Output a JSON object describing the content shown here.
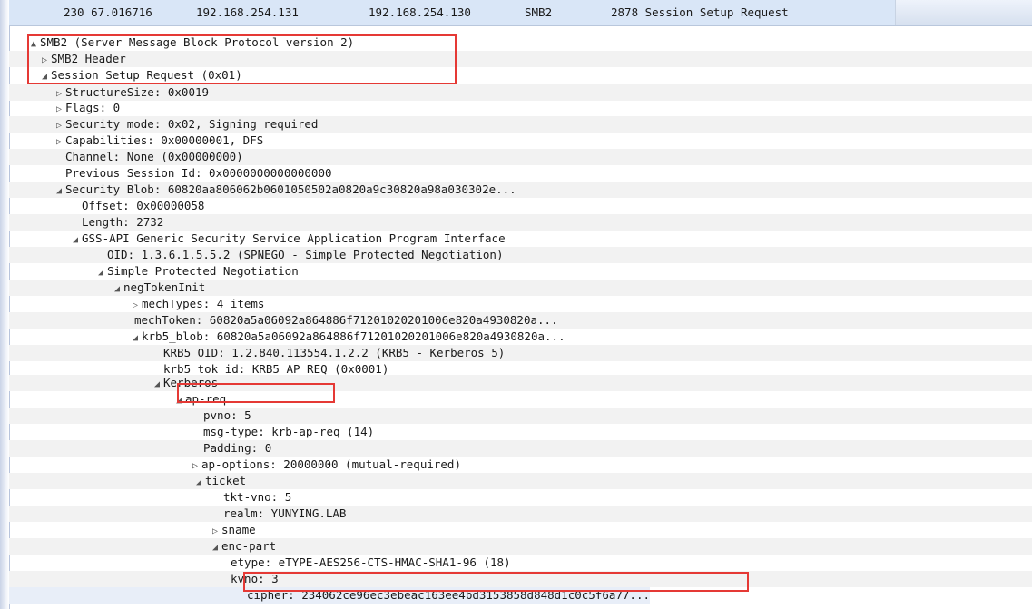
{
  "packet": {
    "no_time": "230 67.016716",
    "src": "192.168.254.131",
    "dst": "192.168.254.130",
    "proto": "SMB2",
    "info": "2878 Session Setup Request"
  },
  "tree": [
    {
      "t": "SMB2 (Server Message Block Protocol version 2)",
      "toggle": "▲"
    },
    {
      "t": "SMB2 Header",
      "toggle": "▷"
    },
    {
      "t": "Session Setup Request (0x01)",
      "toggle": "◢"
    },
    {
      "t": "StructureSize: 0x0019",
      "toggle": "▷"
    },
    {
      "t": "Flags: 0",
      "toggle": "▷"
    },
    {
      "t": "Security mode: 0x02, Signing required",
      "toggle": "▷"
    },
    {
      "t": "Capabilities: 0x00000001, DFS",
      "toggle": "▷"
    },
    {
      "t": "Channel: None (0x00000000)",
      "toggle": ""
    },
    {
      "t": "Previous Session Id: 0x0000000000000000",
      "toggle": ""
    },
    {
      "t": "Security Blob: 60820aa806062b0601050502a0820a9c30820a98a030302e...",
      "toggle": "◢"
    },
    {
      "t": "Offset: 0x00000058",
      "toggle": ""
    },
    {
      "t": "Length: 2732",
      "toggle": ""
    },
    {
      "t": "GSS-API Generic Security Service Application Program Interface",
      "toggle": "◢"
    },
    {
      "t": "OID: 1.3.6.1.5.5.2 (SPNEGO - Simple Protected Negotiation)",
      "toggle": ""
    },
    {
      "t": "Simple Protected Negotiation",
      "toggle": "◢"
    },
    {
      "t": "negTokenInit",
      "toggle": "◢"
    },
    {
      "t": "mechTypes: 4 items",
      "toggle": "▷"
    },
    {
      "t": "mechToken: 60820a5a06092a864886f71201020201006e820a4930820a...",
      "toggle": ""
    },
    {
      "t": "krb5_blob: 60820a5a06092a864886f71201020201006e820a4930820a...",
      "toggle": "◢"
    },
    {
      "t": "KRB5 OID: 1.2.840.113554.1.2.2 (KRB5 - Kerberos 5)",
      "toggle": ""
    },
    {
      "t": "krb5_tok_id: KRB5_AP_REQ (0x0001)",
      "toggle": ""
    },
    {
      "t": "Kerberos",
      "toggle": "◢"
    },
    {
      "t": "ap-req",
      "toggle": "◢"
    },
    {
      "t": "pvno: 5",
      "toggle": ""
    },
    {
      "t": "msg-type: krb-ap-req (14)",
      "toggle": ""
    },
    {
      "t": "Padding: 0",
      "toggle": ""
    },
    {
      "t": "ap-options: 20000000 (mutual-required)",
      "toggle": "▷"
    },
    {
      "t": "ticket",
      "toggle": "◢"
    },
    {
      "t": "tkt-vno: 5",
      "toggle": ""
    },
    {
      "t": "realm: YUNYING.LAB",
      "toggle": ""
    },
    {
      "t": "sname",
      "toggle": "▷"
    },
    {
      "t": "enc-part",
      "toggle": "◢"
    },
    {
      "t": "etype: eTYPE-AES256-CTS-HMAC-SHA1-96 (18)",
      "toggle": ""
    },
    {
      "t": "kvno: 3",
      "toggle": ""
    },
    {
      "t": "cipher: 234062ce96ec3ebeac163ee4bd3153858d848d1c0c5f6a77...",
      "toggle": ""
    }
  ]
}
